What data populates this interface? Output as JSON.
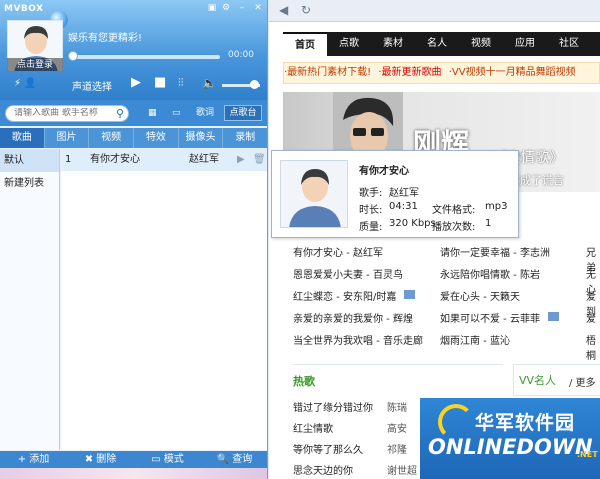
{
  "player": {
    "app_name": "MVBOX",
    "login_label": "点击登录",
    "slogan": "娱乐有您更精彩!",
    "time": "00:00",
    "channel_label": "声道选择",
    "search_placeholder": "请输入歌曲 歌手名称",
    "lyrics_label": "歌词",
    "request_label": "点歌台",
    "tabs": [
      {
        "label": "歌曲"
      },
      {
        "label": "图片"
      },
      {
        "label": "视频"
      },
      {
        "label": "特效"
      },
      {
        "label": "摄像头"
      },
      {
        "label": "录制"
      }
    ],
    "lists": [
      {
        "label": "默认"
      },
      {
        "label": "新建列表"
      }
    ],
    "songs": [
      {
        "index": "1",
        "title": "有你才安心",
        "artist": "赵红军"
      }
    ],
    "bottom_buttons": [
      {
        "label": "+ 添加"
      },
      {
        "label": "✖ 删除"
      },
      {
        "label": "▭ 模式"
      },
      {
        "label": "🔍 查询"
      }
    ]
  },
  "browser": {
    "nav": [
      {
        "label": "首页"
      },
      {
        "label": "点歌"
      },
      {
        "label": "素材"
      },
      {
        "label": "名人"
      },
      {
        "label": "视频"
      },
      {
        "label": "应用"
      },
      {
        "label": "社区"
      }
    ],
    "marquee": [
      {
        "text": "·最新热门素材下载!",
        "color": "#c13a00"
      },
      {
        "text": "·最新更新歌曲",
        "color": "#e00000"
      },
      {
        "text": "·VV视频十一月精品舞蹈视频",
        "color": "#c13a00"
      }
    ],
    "banner": {
      "title": "刚辉",
      "subtitle": "《央情歌》",
      "tagline": "眷变成了谎言"
    },
    "song_rows": [
      [
        {
          "text": "有你才安心 - 赵红军"
        },
        {
          "text": "请你一定要幸福 - 李志洲"
        },
        {
          "text": "兄弟"
        }
      ],
      [
        {
          "text": "恩恩爱爱小夫妻 - 百灵鸟"
        },
        {
          "text": "永远陪你唱情歌 - 陈岩"
        },
        {
          "text": "无心"
        }
      ],
      [
        {
          "text": "红尘蝶恋 - 安东阳/时嘉"
        },
        {
          "text": "爱在心头 - 天籁天"
        },
        {
          "text": "爱到"
        }
      ],
      [
        {
          "text": "亲爱的亲爱的我爱你 - 辉煌"
        },
        {
          "text": "如果可以不爱 - 云菲菲"
        },
        {
          "text": "爱"
        }
      ],
      [
        {
          "text": "当全世界为我欢唱 - 音乐走廊"
        },
        {
          "text": "烟雨江南 - 蓝沁"
        },
        {
          "text": "梧桐"
        }
      ]
    ],
    "hot_title": "热歌",
    "vv_title": "VV名人",
    "vv_more": "/ 更多",
    "hot_songs": [
      {
        "title": "错过了缘分错过你",
        "artist": "陈瑞"
      },
      {
        "title": "红尘情歌",
        "artist": "高安"
      },
      {
        "title": "等你等了那么久",
        "artist": "祁隆"
      },
      {
        "title": "思念天边的你",
        "artist": "谢世超"
      }
    ]
  },
  "tooltip": {
    "title": "有你才安心",
    "singer_label": "歌手:",
    "singer": "赵红军",
    "duration_label": "时长:",
    "duration": "04:31",
    "format_label": "文件格式:",
    "format": "mp3",
    "quality_label": "质量:",
    "quality": "320 Kbps",
    "plays_label": "播放次数:",
    "plays": "1"
  },
  "watermark": {
    "cn": "华军软件园",
    "en": "ONLINEDOWN",
    "net": ".NET"
  },
  "colors": {
    "player_blue": "#3d8ad4",
    "nav_black": "#1a1a1a",
    "hot_green": "#3b9b29"
  }
}
